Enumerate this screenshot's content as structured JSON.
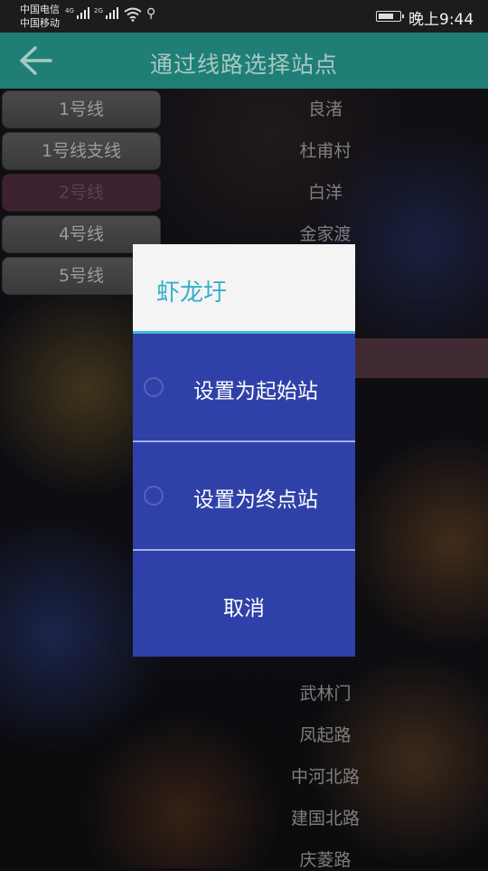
{
  "statusbar": {
    "carrier1": "中国电信",
    "carrier2": "中国移动",
    "net1": "4G",
    "net2": "2G",
    "time": "晚上9:44",
    "battery_level": 0.8
  },
  "appbar": {
    "title": "通过线路选择站点",
    "back_icon": "arrow-left-icon"
  },
  "lines": [
    "1号线",
    "1号线支线",
    "2号线",
    "4号线",
    "5号线"
  ],
  "selected_line_index": 2,
  "stations_top": [
    "良渚",
    "杜甫村",
    "白洋",
    "金家渡"
  ],
  "stations_bottom": [
    "武林门",
    "凤起路",
    "中河北路",
    "建国北路",
    "庆菱路"
  ],
  "dialog": {
    "title": "虾龙圩",
    "option_start": "设置为起始站",
    "option_end": "设置为终点站",
    "cancel": "取消"
  },
  "colors": {
    "appbar": "#1f7f76",
    "dialog_body": "#2f41a8",
    "dialog_title": "#35aecb",
    "dialog_accent": "#3fb6dd"
  }
}
